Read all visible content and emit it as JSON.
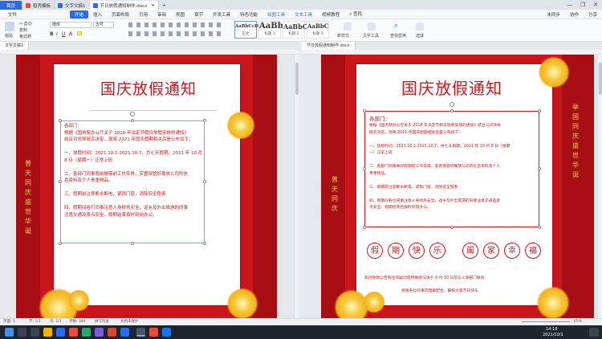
{
  "titlebar": {
    "tabs": [
      "首页",
      "稻壳模板",
      "文字文稿1",
      "节日放假通知制作.docx"
    ],
    "close_glyph": "×",
    "new_tab_glyph": "+",
    "controls": [
      "—",
      "❐",
      "✕"
    ]
  },
  "menubar": {
    "file": "文件",
    "start": "开始",
    "items": [
      "插入",
      "页面布局",
      "引用",
      "审阅",
      "视图",
      "章节",
      "开发工具",
      "特色功能"
    ],
    "tools": [
      "绘图工具",
      "文本工具"
    ],
    "extra": [
      "视频教程",
      "查找"
    ],
    "right": [
      "未同步",
      "协作",
      "分享"
    ]
  },
  "ribbon": {
    "paste": "粘贴",
    "cut": "剪切",
    "copy": "复制",
    "format_painter": "格式刷",
    "font": "楷体",
    "font_size": "五号",
    "styles": [
      {
        "preview": "AaBbCcDd",
        "label": "正文"
      },
      {
        "preview": "AaBb",
        "label": "标题 1"
      },
      {
        "preview": "AaBbC",
        "label": "标题 2"
      },
      {
        "preview": "AaBbC",
        "label": "标题 3"
      }
    ],
    "new_style": "新样式",
    "text_tools": "文字工具",
    "find_replace": "查找替换",
    "select": "选择"
  },
  "left_doc": {
    "tab": "文字文稿1",
    "title": "国庆放假通知",
    "lines": [
      "各部门：",
      "    根据《国务院办公厅关于 2018 年法定节假日放假安排的通知》",
      "结合对领导研究决定，现将 2021 年国庆假期相关后是公布如下：",
      "",
      "一、放假时间：2021.10.1-2021.10.7，共七天假期，2021 年 10 月",
      "8 日（星期一）正常上班",
      "",
      "二、各部门同事假前做需前工作安排，安置保管好属放公司的信",
      "息资料及个人贵重物品。",
      "",
      "三、假期前注意断水断电，紧锁门窗，消除安全隐患",
      "",
      "四、假期间各们同事注意人身财务安全，返乡及外出旅游的同事",
      "注意交通及景点安全，假期结束按时到岗办公。"
    ],
    "vertical_text": "普天同庆 盛世华诞"
  },
  "right_doc": {
    "tab": "节日放假通知制作.docx",
    "title": "国庆放假通知",
    "lines": [
      "各部门：",
      "    根据《国务院办公厅关于 2018 年法定节假日放假安排的通知》结合公司领导",
      "研究决定，现将 2021 年国庆假期相关后是公布如下：",
      "",
      "一、放假时间：2021.10.1-2021.10.7，共七天假期，2021 年 10 月 8 日（星期",
      "一）正常上班",
      "",
      "二、各部门同事做好假期前工作安排，妥善保管好属放公司的信息资料及个人",
      "贵重物品。",
      "",
      "三、假期前注意断水断电，紧锁门窗，消除安全隐患",
      "",
      "四、假期间各位同事注意人身财务安全，返乡及外出旅游的同事注意交通及景",
      "点安全。假期结束后按时到岗办公。"
    ],
    "vertical_left": "普天同庆",
    "vertical_right": "举国同庆 盛世华诞",
    "chars": [
      "假",
      "期",
      "快",
      "乐",
      "阖",
      "家",
      "幸",
      "福"
    ],
    "footer1": "如对放假公告有任何疑问或特殊情况请于 9 月 30 日前与人事部门联系",
    "footer2": "感谢各位同事的理解配合，最祝大家节日快乐"
  },
  "statusbar": {
    "page": "页面: 1",
    "section": "节: 1/1",
    "pages": "页: 1/1",
    "words": "字数: 384",
    "spell": "拼写检查",
    "compat": "文档未保护",
    "zoom": "65%"
  },
  "taskbar": {
    "time": "14:19",
    "date": "2021/10/1"
  }
}
